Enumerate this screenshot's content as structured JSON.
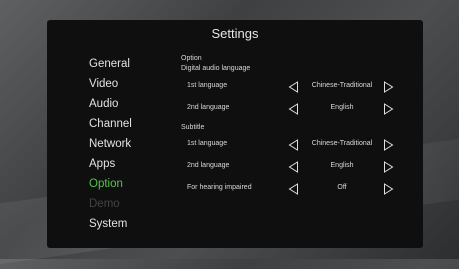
{
  "title": "Settings",
  "menu": {
    "items": [
      {
        "label": "General",
        "state": "normal"
      },
      {
        "label": "Video",
        "state": "normal"
      },
      {
        "label": "Audio",
        "state": "normal"
      },
      {
        "label": "Channel",
        "state": "normal"
      },
      {
        "label": "Network",
        "state": "normal"
      },
      {
        "label": "Apps",
        "state": "normal"
      },
      {
        "label": "Option",
        "state": "active"
      },
      {
        "label": "Demo",
        "state": "disabled"
      },
      {
        "label": "System",
        "state": "normal"
      }
    ]
  },
  "content": {
    "section_option": "Option",
    "section_audio": "Digital audio language",
    "section_subtitle": "Subtitle",
    "audio_rows": [
      {
        "label": "1st language",
        "value": "Chinese-Traditional"
      },
      {
        "label": "2nd language",
        "value": "English"
      }
    ],
    "subtitle_rows": [
      {
        "label": "1st language",
        "value": "Chinese-Traditional"
      },
      {
        "label": "2nd language",
        "value": "English"
      },
      {
        "label": "For hearing impaired",
        "value": "Off"
      }
    ]
  },
  "icons": {
    "left": "triangle-left-icon",
    "right": "triangle-right-icon"
  },
  "colors": {
    "active": "#5ac34d",
    "disabled": "#444444",
    "panel": "#0f0f10",
    "text": "#d9d9d9"
  }
}
